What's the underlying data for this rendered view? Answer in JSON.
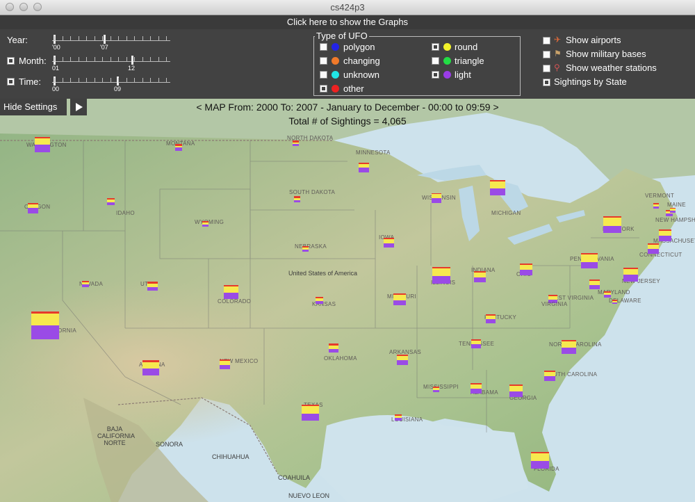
{
  "window": {
    "title": "cs424p3"
  },
  "graphs_banner": "Click here to show the Graphs",
  "settings": {
    "year": {
      "label": "Year:",
      "start": "'00",
      "end": "'07",
      "checked": false
    },
    "month": {
      "label": "Month:",
      "start": "01",
      "end": "12",
      "checked": true
    },
    "time": {
      "label": "Time:",
      "start": "00",
      "end": "09",
      "checked": true
    },
    "ufo_types": {
      "title": "Type of UFO",
      "items": [
        {
          "label": "polygon",
          "color": "#2323e6",
          "checked": false
        },
        {
          "label": "changing",
          "color": "#f07a2a",
          "checked": false
        },
        {
          "label": "unknown",
          "color": "#21e6e6",
          "checked": false
        },
        {
          "label": "other",
          "color": "#ee2222",
          "checked": true
        },
        {
          "label": "round",
          "color": "#f2f22a",
          "checked": true
        },
        {
          "label": "triangle",
          "color": "#22dd44",
          "checked": false
        },
        {
          "label": "light",
          "color": "#9a3ce6",
          "checked": true
        }
      ]
    },
    "layers": [
      {
        "label": "Show airports",
        "icon": "airplane-icon",
        "checked": false
      },
      {
        "label": "Show military bases",
        "icon": "military-base-icon",
        "checked": false
      },
      {
        "label": "Show weather stations",
        "icon": "weather-station-icon",
        "checked": false
      },
      {
        "label": "Sightings by State",
        "icon": "",
        "checked": true
      }
    ]
  },
  "controls": {
    "hide_settings": "Hide Settings",
    "play_icon": "play-icon"
  },
  "map": {
    "header": "< MAP From: 2000 To: 2007 - January to December - 00:00 to 09:59 >",
    "total": "Total # of Sightings = 4,065",
    "colors": {
      "other": "#e63a2b",
      "round": "#f6e94f",
      "light": "#9a4be6"
    },
    "country_labels": {
      "usa": "United States of America",
      "baja": "BAJA CALIFORNIA NORTE",
      "sonora": "SONORA",
      "chihuahua": "CHIHUAHUA",
      "coahuila": "COAHUILA",
      "nuevo_leon": "NUEVO LEON"
    },
    "states": [
      {
        "name": "WASHINGTON",
        "other": 0.09,
        "round": 0.4,
        "light": 0.51
      },
      {
        "name": "MONTANA",
        "other": 0.25,
        "round": 0.25,
        "light": 0.5
      },
      {
        "name": "NORTH DAKOTA",
        "other": 0.34,
        "round": 0.33,
        "light": 0.33
      },
      {
        "name": "MINNESOTA",
        "other": 0.15,
        "round": 0.38,
        "light": 0.47
      },
      {
        "name": "OREGON",
        "other": 0.14,
        "round": 0.36,
        "light": 0.5
      },
      {
        "name": "IDAHO",
        "other": 0.2,
        "round": 0.4,
        "light": 0.4
      },
      {
        "name": "WYOMING",
        "other": 0.3,
        "round": 0.3,
        "light": 0.4
      },
      {
        "name": "SOUTH DAKOTA",
        "other": 0.34,
        "round": 0.33,
        "light": 0.33
      },
      {
        "name": "WISCONSIN",
        "other": 0.1,
        "round": 0.4,
        "light": 0.5
      },
      {
        "name": "MICHIGAN",
        "other": 0.1,
        "round": 0.45,
        "light": 0.45
      },
      {
        "name": "NEW YORK",
        "other": 0.07,
        "round": 0.5,
        "light": 0.43
      },
      {
        "name": "VERMONT",
        "other": 0.3,
        "round": 0.3,
        "light": 0.4
      },
      {
        "name": "NEW HAMPSHIRE",
        "other": 0.2,
        "round": 0.4,
        "light": 0.4
      },
      {
        "name": "MAINE",
        "other": 0.2,
        "round": 0.4,
        "light": 0.4
      },
      {
        "name": "MASSACHUSETTS",
        "other": 0.1,
        "round": 0.45,
        "light": 0.45
      },
      {
        "name": "CONNECTICUT",
        "other": 0.15,
        "round": 0.4,
        "light": 0.45
      },
      {
        "name": "NEBRASKA",
        "other": 0.3,
        "round": 0.3,
        "light": 0.4
      },
      {
        "name": "IOWA",
        "other": 0.15,
        "round": 0.4,
        "light": 0.45
      },
      {
        "name": "ILLINOIS",
        "other": 0.08,
        "round": 0.45,
        "light": 0.47
      },
      {
        "name": "INDIANA",
        "other": 0.1,
        "round": 0.45,
        "light": 0.45
      },
      {
        "name": "OHIO",
        "other": 0.1,
        "round": 0.45,
        "light": 0.45
      },
      {
        "name": "PENNSYLVANIA",
        "other": 0.07,
        "round": 0.5,
        "light": 0.43
      },
      {
        "name": "NEW JERSEY",
        "other": 0.1,
        "round": 0.4,
        "light": 0.5
      },
      {
        "name": "NEVADA",
        "other": 0.2,
        "round": 0.4,
        "light": 0.4
      },
      {
        "name": "UTAH",
        "other": 0.2,
        "round": 0.4,
        "light": 0.4
      },
      {
        "name": "COLORADO",
        "other": 0.12,
        "round": 0.45,
        "light": 0.43
      },
      {
        "name": "KANSAS",
        "other": 0.2,
        "round": 0.4,
        "light": 0.4
      },
      {
        "name": "MISSOURI",
        "other": 0.12,
        "round": 0.44,
        "light": 0.44
      },
      {
        "name": "KENTUCKY",
        "other": 0.15,
        "round": 0.4,
        "light": 0.45
      },
      {
        "name": "WEST VIRGINIA",
        "other": 0.2,
        "round": 0.4,
        "light": 0.4
      },
      {
        "name": "VIRGINIA",
        "other": 0.14,
        "round": 0.4,
        "light": 0.46
      },
      {
        "name": "MARYLAND",
        "other": 0.2,
        "round": 0.4,
        "light": 0.4
      },
      {
        "name": "DELAWARE",
        "other": 0.3,
        "round": 0.3,
        "light": 0.4
      },
      {
        "name": "CALIFORNIA",
        "other": 0.08,
        "round": 0.42,
        "light": 0.5
      },
      {
        "name": "ARIZONA",
        "other": 0.12,
        "round": 0.43,
        "light": 0.45
      },
      {
        "name": "NEW MEXICO",
        "other": 0.15,
        "round": 0.4,
        "light": 0.45
      },
      {
        "name": "OKLAHOMA",
        "other": 0.2,
        "round": 0.4,
        "light": 0.4
      },
      {
        "name": "ARKANSAS",
        "other": 0.15,
        "round": 0.4,
        "light": 0.45
      },
      {
        "name": "TENNESSEE",
        "other": 0.15,
        "round": 0.4,
        "light": 0.45
      },
      {
        "name": "NORTH CAROLINA",
        "other": 0.1,
        "round": 0.45,
        "light": 0.45
      },
      {
        "name": "SOUTH CAROLINA",
        "other": 0.15,
        "round": 0.4,
        "light": 0.45
      },
      {
        "name": "TEXAS",
        "other": 0.1,
        "round": 0.45,
        "light": 0.45
      },
      {
        "name": "LOUISIANA",
        "other": 0.2,
        "round": 0.4,
        "light": 0.4
      },
      {
        "name": "MISSISSIPPI",
        "other": 0.2,
        "round": 0.4,
        "light": 0.4
      },
      {
        "name": "ALABAMA",
        "other": 0.15,
        "round": 0.4,
        "light": 0.45
      },
      {
        "name": "GEORGIA",
        "other": 0.12,
        "round": 0.44,
        "light": 0.44
      },
      {
        "name": "FLORIDA",
        "other": 0.1,
        "round": 0.45,
        "light": 0.45
      }
    ]
  }
}
